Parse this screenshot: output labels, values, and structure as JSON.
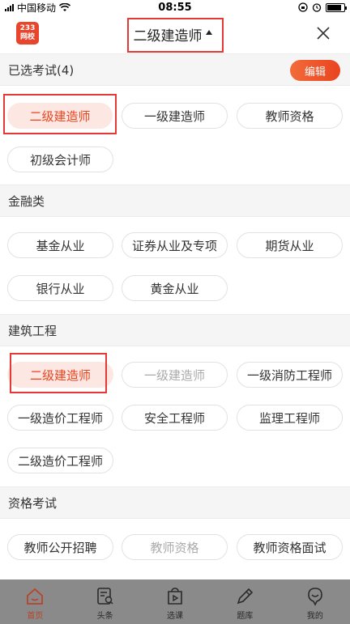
{
  "status_bar": {
    "carrier": "中国移动",
    "time": "08:55"
  },
  "header": {
    "logo_line1": "233",
    "logo_line2": "网校",
    "title": "二级建造师"
  },
  "selected": {
    "label": "已选考试(4)",
    "edit_label": "编辑",
    "items": [
      "二级建造师",
      "一级建造师",
      "教师资格",
      "初级会计师"
    ]
  },
  "finance": {
    "label": "金融类",
    "items": [
      "基金从业",
      "证券从业及专项",
      "期货从业",
      "银行从业",
      "黄金从业"
    ]
  },
  "construction": {
    "label": "建筑工程",
    "items": [
      "二级建造师",
      "一级建造师",
      "一级消防工程师",
      "一级造价工程师",
      "安全工程师",
      "监理工程师",
      "二级造价工程师"
    ]
  },
  "qualification": {
    "label": "资格考试",
    "items": [
      "教师公开招聘",
      "教师资格",
      "教师资格面试"
    ]
  },
  "bottom_nav": {
    "items": [
      {
        "label": "首页",
        "icon": "home-icon"
      },
      {
        "label": "头条",
        "icon": "news-icon"
      },
      {
        "label": "选课",
        "icon": "course-icon"
      },
      {
        "label": "题库",
        "icon": "pen-icon"
      },
      {
        "label": "我的",
        "icon": "profile-icon"
      }
    ]
  },
  "colors": {
    "accent": "#e9441f",
    "active_chip_bg": "#fde7e2",
    "highlight_border": "#e53935"
  }
}
